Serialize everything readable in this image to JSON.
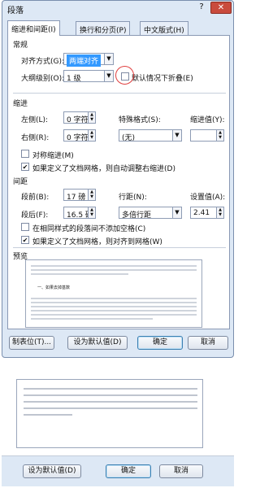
{
  "dialog": {
    "title": "段落",
    "help_glyph": "?",
    "close_glyph": "✕"
  },
  "tabs": [
    {
      "label": "缩进和间距(I)"
    },
    {
      "label": "换行和分页(P)"
    },
    {
      "label": "中文版式(H)"
    }
  ],
  "general": {
    "heading": "常规",
    "alignment_label": "对齐方式(G):",
    "alignment_value": "两端对齐",
    "outline_label": "大纲级别(O):",
    "outline_value": "1 级",
    "collapse_label": "默认情况下折叠(E)"
  },
  "indent": {
    "heading": "缩进",
    "left_label": "左侧(L):",
    "left_value": "0 字符",
    "right_label": "右侧(R):",
    "right_value": "0 字符",
    "special_label": "特殊格式(S):",
    "special_value": "(无)",
    "indent_value_label": "缩进值(Y):",
    "indent_value": "",
    "mirror_label": "对称缩进(M)",
    "mirror_checked": false,
    "auto_adjust_label": "如果定义了文档网格，则自动调整右缩进(D)",
    "auto_adjust_checked": true
  },
  "spacing": {
    "heading": "间距",
    "before_label": "段前(B):",
    "before_value": "17 磅",
    "after_label": "段后(F):",
    "after_value": "16.5 磅",
    "line_spacing_label": "行距(N):",
    "line_spacing_value": "多倍行距",
    "at_label": "设置值(A):",
    "at_value": "2.41",
    "no_space_label": "在相同样式的段落间不添加空格(C)",
    "no_space_checked": false,
    "snap_grid_label": "如果定义了文档网格，则对齐到网格(W)",
    "snap_grid_checked": true
  },
  "preview": {
    "heading": "预览",
    "sample_text": "一、如果去掉基数"
  },
  "buttons": {
    "tabs": "制表位(T)...",
    "set_default": "设为默认值(D)",
    "ok": "确定",
    "cancel": "取消"
  },
  "zoomed": {
    "set_default": "设为默认值(D)",
    "ok": "确定",
    "cancel": "取消"
  }
}
